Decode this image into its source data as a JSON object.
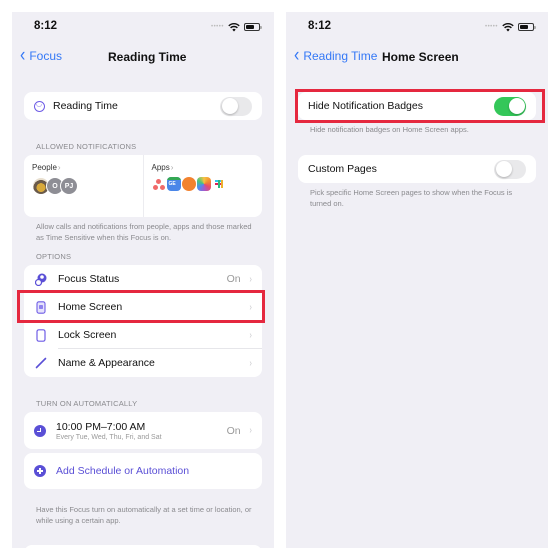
{
  "left": {
    "status": {
      "time": "8:12"
    },
    "nav": {
      "back_label": "Focus",
      "title": "Reading Time"
    },
    "focus_toggle": {
      "label": "Reading Time",
      "on": false
    },
    "allowed_notifications": {
      "header": "ALLOWED NOTIFICATIONS",
      "people": {
        "title": "People",
        "avatars": [
          "photo",
          "O",
          "PJ"
        ]
      },
      "apps": {
        "title": "Apps",
        "icons": [
          "asana",
          "google-news",
          "orange-app",
          "photos",
          "slack"
        ]
      },
      "footnote": "Allow calls and notifications from people, apps and those marked as Time Sensitive when this Focus is on."
    },
    "options": {
      "header": "OPTIONS",
      "items": [
        {
          "label": "Focus Status",
          "value": "On",
          "icon": "focus-status-icon"
        },
        {
          "label": "Home Screen",
          "value": "",
          "icon": "home-screen-icon",
          "highlighted": true
        },
        {
          "label": "Lock Screen",
          "value": "",
          "icon": "lock-screen-icon"
        },
        {
          "label": "Name & Appearance",
          "value": "",
          "icon": "pencil-icon"
        }
      ]
    },
    "turn_on_automatically": {
      "header": "TURN ON AUTOMATICALLY",
      "schedule": {
        "time": "10:00 PM–7:00 AM",
        "days": "Every Tue, Wed, Thu, Fri, and Sat",
        "value": "On"
      },
      "add_label": "Add Schedule or Automation",
      "footnote": "Have this Focus turn on automatically at a set time or location, or while using a certain app."
    }
  },
  "right": {
    "status": {
      "time": "8:12"
    },
    "nav": {
      "back_label": "Reading Time",
      "title": "Home Screen"
    },
    "hide_badges": {
      "label": "Hide Notification Badges",
      "on": true,
      "footnote": "Hide notification badges on Home Screen apps.",
      "highlighted": true
    },
    "custom_pages": {
      "label": "Custom Pages",
      "on": false,
      "footnote": "Pick specific Home Screen pages to show when the Focus is turned on."
    }
  },
  "colors": {
    "accent": "#3478f6",
    "focus_purple": "#5a4fd6",
    "toggle_on": "#34c759",
    "highlight": "#e5283f",
    "background": "#f0eff5"
  }
}
